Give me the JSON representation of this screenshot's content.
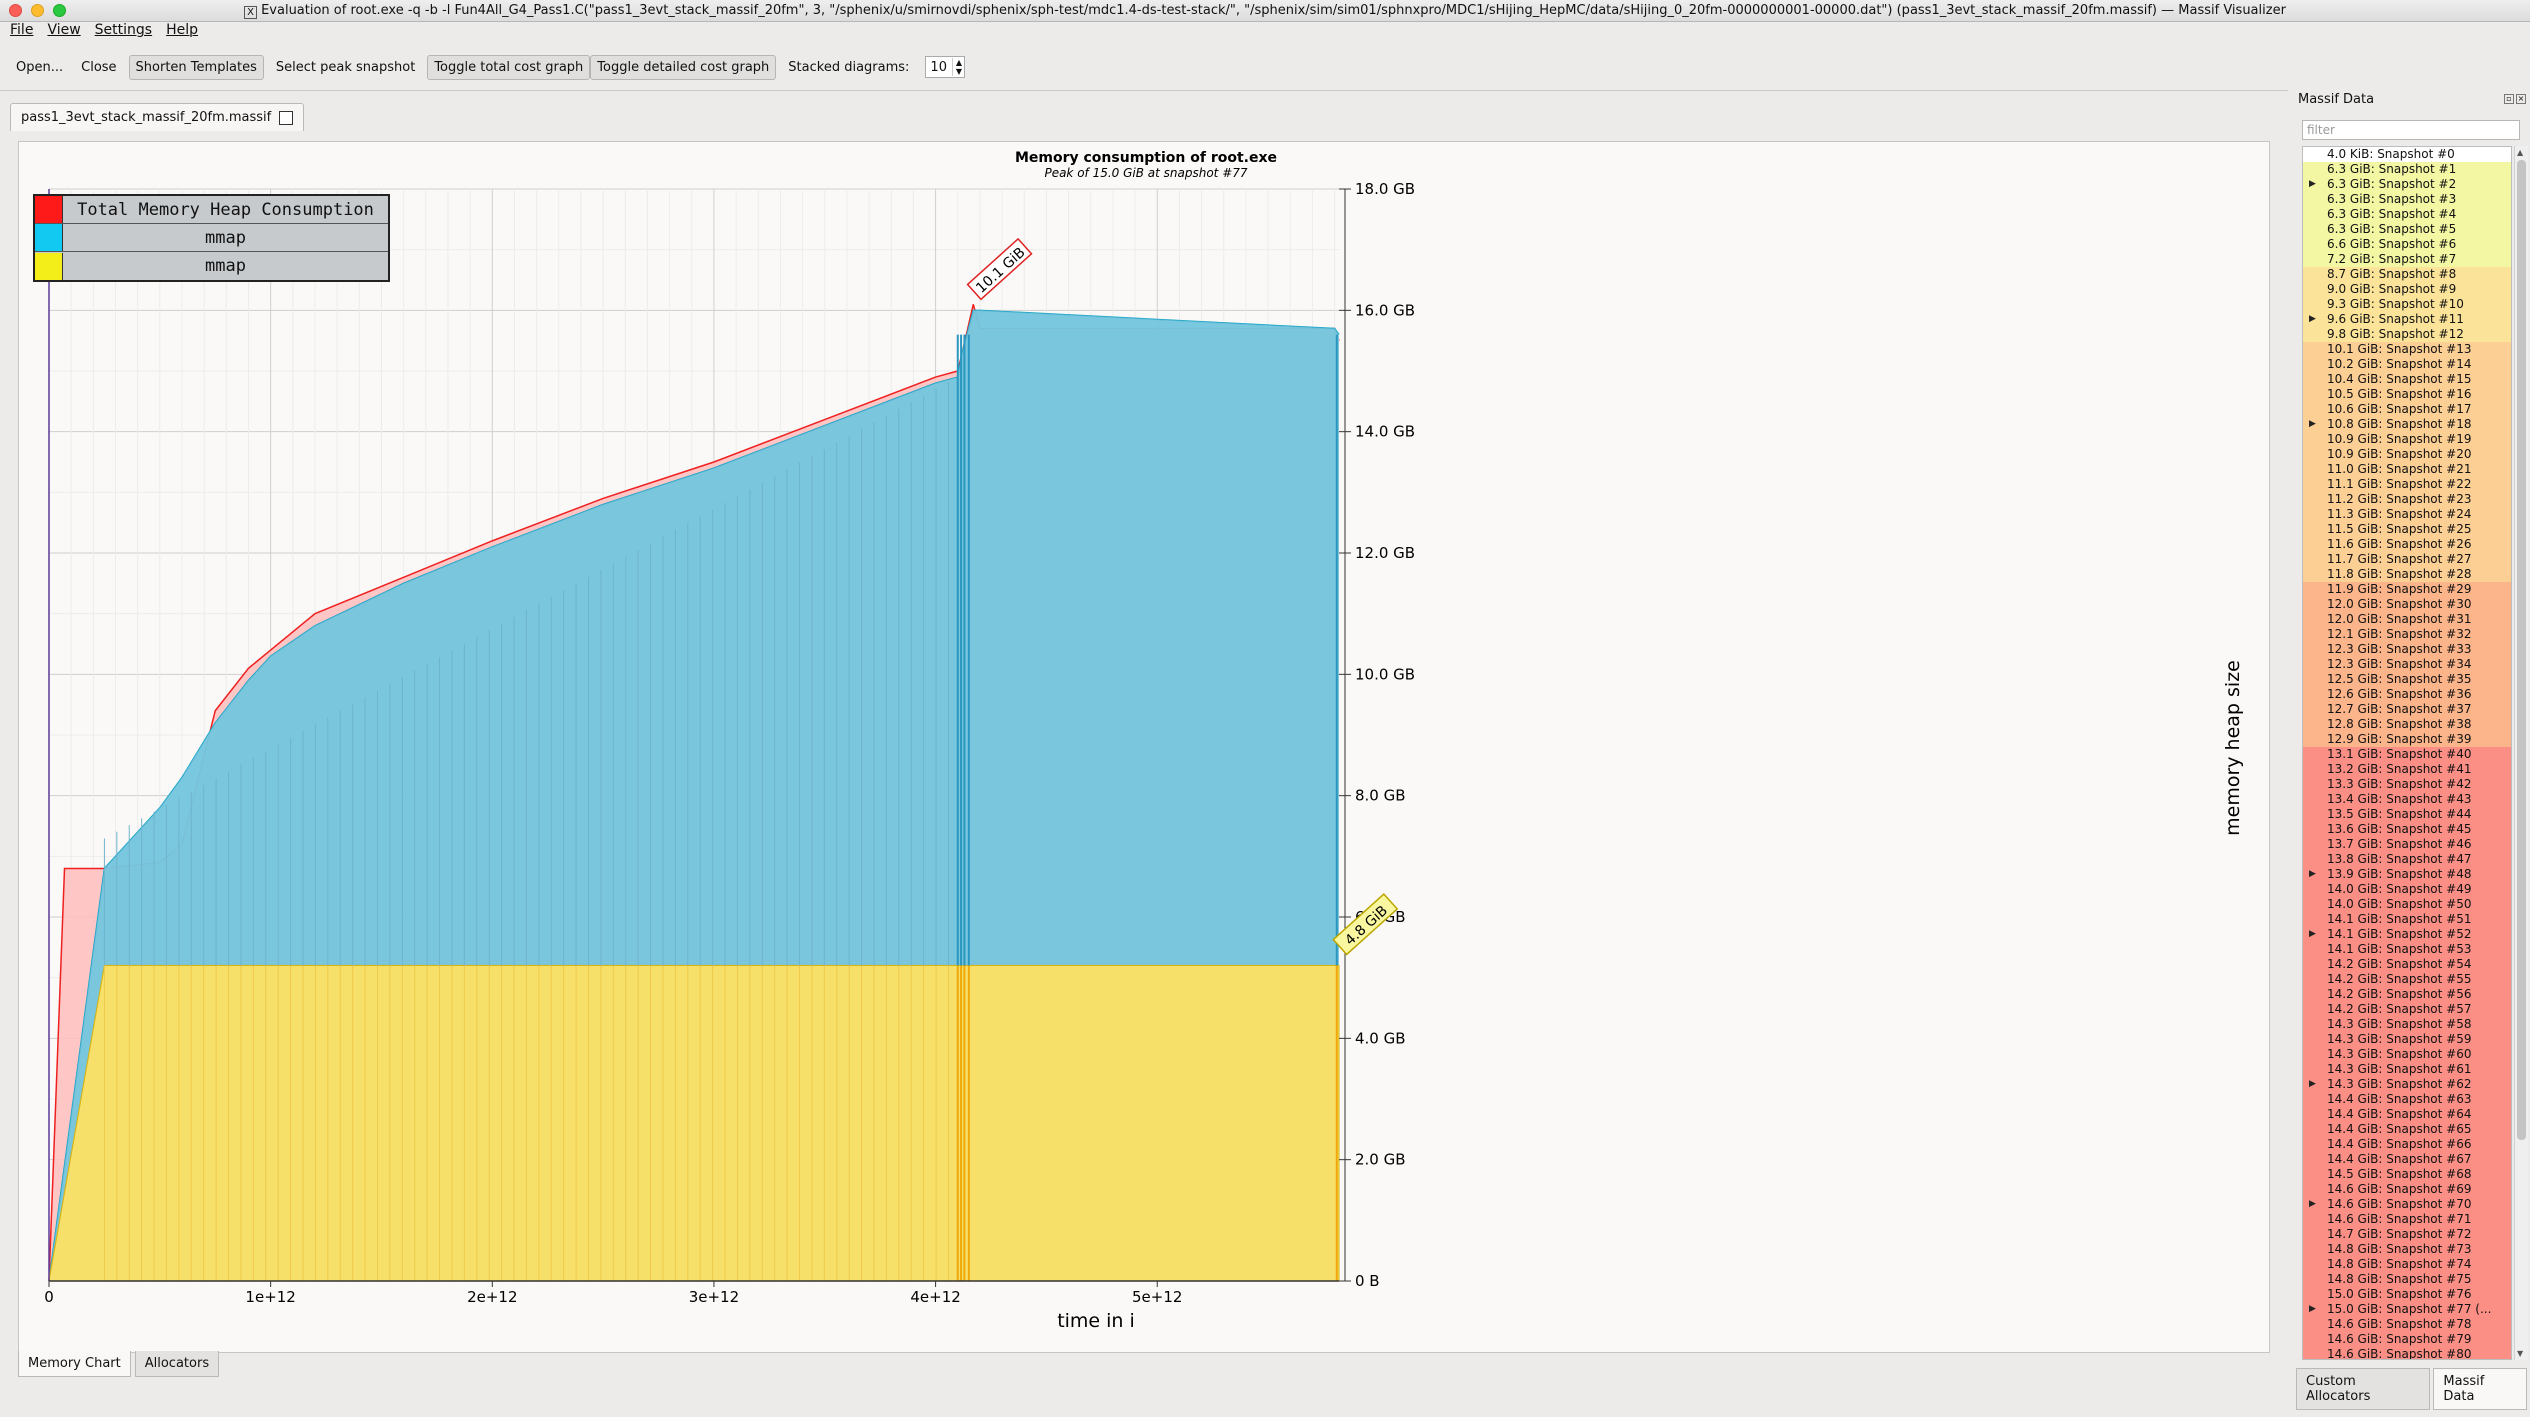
{
  "window": {
    "title": "Evaluation of root.exe -q -b -l Fun4All_G4_Pass1.C(\"pass1_3evt_stack_massif_20fm\", 3, \"/sphenix/u/smirnovdi/sphenix/sph-test/mdc1.4-ds-test-stack/\", \"/sphenix/sim/sim01/sphnxpro/MDC1/sHijing_HepMC/data/sHijing_0_20fm-0000000001-00000.dat\") (pass1_3evt_stack_massif_20fm.massif) — Massif Visualizer",
    "x_glyph": "X"
  },
  "menu": [
    "File",
    "View",
    "Settings",
    "Help"
  ],
  "toolbar": {
    "open": "Open...",
    "close": "Close",
    "shorten": "Shorten Templates",
    "select_peak": "Select peak snapshot",
    "toggle_total": "Toggle total cost graph",
    "toggle_detailed": "Toggle detailed cost graph",
    "stacked_label": "Stacked diagrams:",
    "stacked_value": "10"
  },
  "doc_tab": "pass1_3evt_stack_massif_20fm.massif",
  "bottom_tabs": [
    "Memory Chart",
    "Allocators"
  ],
  "dock": {
    "title": "Massif Data",
    "filter_placeholder": "filter",
    "tabs": [
      "Custom Allocators",
      "Massif Data"
    ]
  },
  "colors": {
    "total": "#ff2a2a",
    "mmap_blue": "#1ec8ee",
    "mmap_yellow": "#f5e11e",
    "stack_blue": "#78c8e0",
    "stack_yellow": "#f6e06a"
  },
  "legend": [
    {
      "label": "Total Memory Heap Consumption",
      "color": "#ff1a1a"
    },
    {
      "label": "mmap",
      "color": "#12c9f2"
    },
    {
      "label": "mmap",
      "color": "#f3ee1a"
    }
  ],
  "chart_data": {
    "type": "area",
    "title": "Memory consumption of root.exe",
    "subtitle": "Peak of 15.0 GiB at snapshot #77",
    "xlabel": "time in i",
    "ylabel": "memory heap size",
    "x_ticks": [
      "0",
      "1e+12",
      "2e+12",
      "3e+12",
      "4e+12",
      "5e+12"
    ],
    "x_tick_values": [
      0,
      1000000000000.0,
      2000000000000.0,
      3000000000000.0,
      4000000000000.0,
      5000000000000.0
    ],
    "y_ticks": [
      "0 B",
      "2.0 GB",
      "4.0 GB",
      "6.0 GB",
      "8.0 GB",
      "10.0 GB",
      "12.0 GB",
      "14.0 GB",
      "16.0 GB",
      "18.0 GB"
    ],
    "xlim": [
      0,
      5820000000000.0
    ],
    "ylim": [
      0,
      18
    ],
    "annotations": [
      {
        "text": "10.1 GiB",
        "x": 4200000000000.0,
        "y": 16.3
      },
      {
        "text": "4.8 GiB",
        "x": 5850000000000.0,
        "y": 5.5
      }
    ],
    "series": [
      {
        "name": "Total Memory Heap Consumption",
        "x": [
          0,
          70000000000.0,
          150000000000.0,
          250000000000.0,
          500000000000.0,
          600000000000.0,
          750000000000.0,
          900000000000.0,
          1000000000000.0,
          1200000000000.0,
          1600000000000.0,
          2000000000000.0,
          2500000000000.0,
          3000000000000.0,
          3500000000000.0,
          4000000000000.0,
          4100000000000.0,
          4120000000000.0,
          4170000000000.0,
          4200000000000.0,
          5800000000000.0,
          5820000000000.0
        ],
        "y": [
          0,
          6.8,
          6.8,
          6.8,
          6.9,
          7.2,
          9.4,
          10.1,
          10.4,
          11.0,
          11.6,
          12.2,
          12.9,
          13.5,
          14.2,
          14.9,
          15.0,
          15.3,
          16.1,
          15.7,
          15.7,
          15.5
        ]
      },
      {
        "name": "mmap",
        "x": [
          0,
          250000000000.0,
          500000000000.0,
          600000000000.0,
          750000000000.0,
          900000000000.0,
          1000000000000.0,
          1200000000000.0,
          1600000000000.0,
          2000000000000.0,
          2500000000000.0,
          3000000000000.0,
          3500000000000.0,
          4000000000000.0,
          4100000000000.0,
          4120000000000.0,
          4170000000000.0,
          4200000000000.0,
          5800000000000.0,
          5820000000000.0
        ],
        "y": [
          0,
          6.8,
          7.8,
          8.3,
          9.2,
          9.9,
          10.3,
          10.8,
          11.5,
          12.1,
          12.8,
          13.4,
          14.1,
          14.8,
          14.9,
          15.3,
          16.0,
          16.0,
          15.7,
          15.6
        ]
      },
      {
        "name": "mmap",
        "x": [
          0,
          250000000000.0,
          4100000000000.0,
          4200000000000.0,
          5800000000000.0,
          5820000000000.0
        ],
        "y": [
          0,
          5.2,
          5.2,
          5.2,
          5.2,
          5.2
        ]
      }
    ]
  },
  "snapshots": [
    {
      "label": "4.0 KiB: Snapshot #0",
      "level": 0,
      "exp": false
    },
    {
      "label": "6.3 GiB: Snapshot #1",
      "level": 1,
      "exp": false
    },
    {
      "label": "6.3 GiB: Snapshot #2",
      "level": 1,
      "exp": true
    },
    {
      "label": "6.3 GiB: Snapshot #3",
      "level": 1,
      "exp": false
    },
    {
      "label": "6.3 GiB: Snapshot #4",
      "level": 1,
      "exp": false
    },
    {
      "label": "6.3 GiB: Snapshot #5",
      "level": 1,
      "exp": false
    },
    {
      "label": "6.6 GiB: Snapshot #6",
      "level": 1,
      "exp": false
    },
    {
      "label": "7.2 GiB: Snapshot #7",
      "level": 1,
      "exp": false
    },
    {
      "label": "8.7 GiB: Snapshot #8",
      "level": 2,
      "exp": false
    },
    {
      "label": "9.0 GiB: Snapshot #9",
      "level": 2,
      "exp": false
    },
    {
      "label": "9.3 GiB: Snapshot #10",
      "level": 2,
      "exp": false
    },
    {
      "label": "9.6 GiB: Snapshot #11",
      "level": 2,
      "exp": true
    },
    {
      "label": "9.8 GiB: Snapshot #12",
      "level": 2,
      "exp": false
    },
    {
      "label": "10.1 GiB: Snapshot #13",
      "level": 3,
      "exp": false
    },
    {
      "label": "10.2 GiB: Snapshot #14",
      "level": 3,
      "exp": false
    },
    {
      "label": "10.4 GiB: Snapshot #15",
      "level": 3,
      "exp": false
    },
    {
      "label": "10.5 GiB: Snapshot #16",
      "level": 3,
      "exp": false
    },
    {
      "label": "10.6 GiB: Snapshot #17",
      "level": 3,
      "exp": false
    },
    {
      "label": "10.8 GiB: Snapshot #18",
      "level": 3,
      "exp": true
    },
    {
      "label": "10.9 GiB: Snapshot #19",
      "level": 3,
      "exp": false
    },
    {
      "label": "10.9 GiB: Snapshot #20",
      "level": 3,
      "exp": false
    },
    {
      "label": "11.0 GiB: Snapshot #21",
      "level": 3,
      "exp": false
    },
    {
      "label": "11.1 GiB: Snapshot #22",
      "level": 3,
      "exp": false
    },
    {
      "label": "11.2 GiB: Snapshot #23",
      "level": 3,
      "exp": false
    },
    {
      "label": "11.3 GiB: Snapshot #24",
      "level": 3,
      "exp": false
    },
    {
      "label": "11.5 GiB: Snapshot #25",
      "level": 3,
      "exp": false
    },
    {
      "label": "11.6 GiB: Snapshot #26",
      "level": 3,
      "exp": false
    },
    {
      "label": "11.7 GiB: Snapshot #27",
      "level": 3,
      "exp": false
    },
    {
      "label": "11.8 GiB: Snapshot #28",
      "level": 3,
      "exp": false
    },
    {
      "label": "11.9 GiB: Snapshot #29",
      "level": 4,
      "exp": false
    },
    {
      "label": "12.0 GiB: Snapshot #30",
      "level": 4,
      "exp": false
    },
    {
      "label": "12.0 GiB: Snapshot #31",
      "level": 4,
      "exp": false
    },
    {
      "label": "12.1 GiB: Snapshot #32",
      "level": 4,
      "exp": false
    },
    {
      "label": "12.3 GiB: Snapshot #33",
      "level": 4,
      "exp": false
    },
    {
      "label": "12.3 GiB: Snapshot #34",
      "level": 4,
      "exp": false
    },
    {
      "label": "12.5 GiB: Snapshot #35",
      "level": 4,
      "exp": false
    },
    {
      "label": "12.6 GiB: Snapshot #36",
      "level": 4,
      "exp": false
    },
    {
      "label": "12.7 GiB: Snapshot #37",
      "level": 4,
      "exp": false
    },
    {
      "label": "12.8 GiB: Snapshot #38",
      "level": 4,
      "exp": false
    },
    {
      "label": "12.9 GiB: Snapshot #39",
      "level": 4,
      "exp": false
    },
    {
      "label": "13.1 GiB: Snapshot #40",
      "level": 5,
      "exp": false
    },
    {
      "label": "13.2 GiB: Snapshot #41",
      "level": 5,
      "exp": false
    },
    {
      "label": "13.3 GiB: Snapshot #42",
      "level": 5,
      "exp": false
    },
    {
      "label": "13.4 GiB: Snapshot #43",
      "level": 5,
      "exp": false
    },
    {
      "label": "13.5 GiB: Snapshot #44",
      "level": 5,
      "exp": false
    },
    {
      "label": "13.6 GiB: Snapshot #45",
      "level": 5,
      "exp": false
    },
    {
      "label": "13.7 GiB: Snapshot #46",
      "level": 5,
      "exp": false
    },
    {
      "label": "13.8 GiB: Snapshot #47",
      "level": 5,
      "exp": false
    },
    {
      "label": "13.9 GiB: Snapshot #48",
      "level": 5,
      "exp": true
    },
    {
      "label": "14.0 GiB: Snapshot #49",
      "level": 5,
      "exp": false
    },
    {
      "label": "14.0 GiB: Snapshot #50",
      "level": 5,
      "exp": false
    },
    {
      "label": "14.1 GiB: Snapshot #51",
      "level": 5,
      "exp": false
    },
    {
      "label": "14.1 GiB: Snapshot #52",
      "level": 5,
      "exp": true
    },
    {
      "label": "14.1 GiB: Snapshot #53",
      "level": 5,
      "exp": false
    },
    {
      "label": "14.2 GiB: Snapshot #54",
      "level": 5,
      "exp": false
    },
    {
      "label": "14.2 GiB: Snapshot #55",
      "level": 5,
      "exp": false
    },
    {
      "label": "14.2 GiB: Snapshot #56",
      "level": 5,
      "exp": false
    },
    {
      "label": "14.2 GiB: Snapshot #57",
      "level": 5,
      "exp": false
    },
    {
      "label": "14.3 GiB: Snapshot #58",
      "level": 5,
      "exp": false
    },
    {
      "label": "14.3 GiB: Snapshot #59",
      "level": 5,
      "exp": false
    },
    {
      "label": "14.3 GiB: Snapshot #60",
      "level": 5,
      "exp": false
    },
    {
      "label": "14.3 GiB: Snapshot #61",
      "level": 5,
      "exp": false
    },
    {
      "label": "14.3 GiB: Snapshot #62",
      "level": 5,
      "exp": true
    },
    {
      "label": "14.4 GiB: Snapshot #63",
      "level": 5,
      "exp": false
    },
    {
      "label": "14.4 GiB: Snapshot #64",
      "level": 5,
      "exp": false
    },
    {
      "label": "14.4 GiB: Snapshot #65",
      "level": 5,
      "exp": false
    },
    {
      "label": "14.4 GiB: Snapshot #66",
      "level": 5,
      "exp": false
    },
    {
      "label": "14.4 GiB: Snapshot #67",
      "level": 5,
      "exp": false
    },
    {
      "label": "14.5 GiB: Snapshot #68",
      "level": 5,
      "exp": false
    },
    {
      "label": "14.6 GiB: Snapshot #69",
      "level": 5,
      "exp": false
    },
    {
      "label": "14.6 GiB: Snapshot #70",
      "level": 5,
      "exp": true
    },
    {
      "label": "14.6 GiB: Snapshot #71",
      "level": 5,
      "exp": false
    },
    {
      "label": "14.7 GiB: Snapshot #72",
      "level": 5,
      "exp": false
    },
    {
      "label": "14.8 GiB: Snapshot #73",
      "level": 5,
      "exp": false
    },
    {
      "label": "14.8 GiB: Snapshot #74",
      "level": 5,
      "exp": false
    },
    {
      "label": "14.8 GiB: Snapshot #75",
      "level": 5,
      "exp": false
    },
    {
      "label": "15.0 GiB: Snapshot #76",
      "level": 5,
      "exp": false
    },
    {
      "label": "15.0 GiB: Snapshot #77 (...",
      "level": 5,
      "exp": true
    },
    {
      "label": "14.6 GiB: Snapshot #78",
      "level": 5,
      "exp": false
    },
    {
      "label": "14.6 GiB: Snapshot #79",
      "level": 5,
      "exp": false
    },
    {
      "label": "14.6 GiB: Snapshot #80",
      "level": 5,
      "exp": false
    }
  ],
  "snapshot_level_colors": [
    "#ffffff",
    "#f3f7a3",
    "#fbe49a",
    "#fccf94",
    "#fcb58a",
    "#fb8f85"
  ]
}
